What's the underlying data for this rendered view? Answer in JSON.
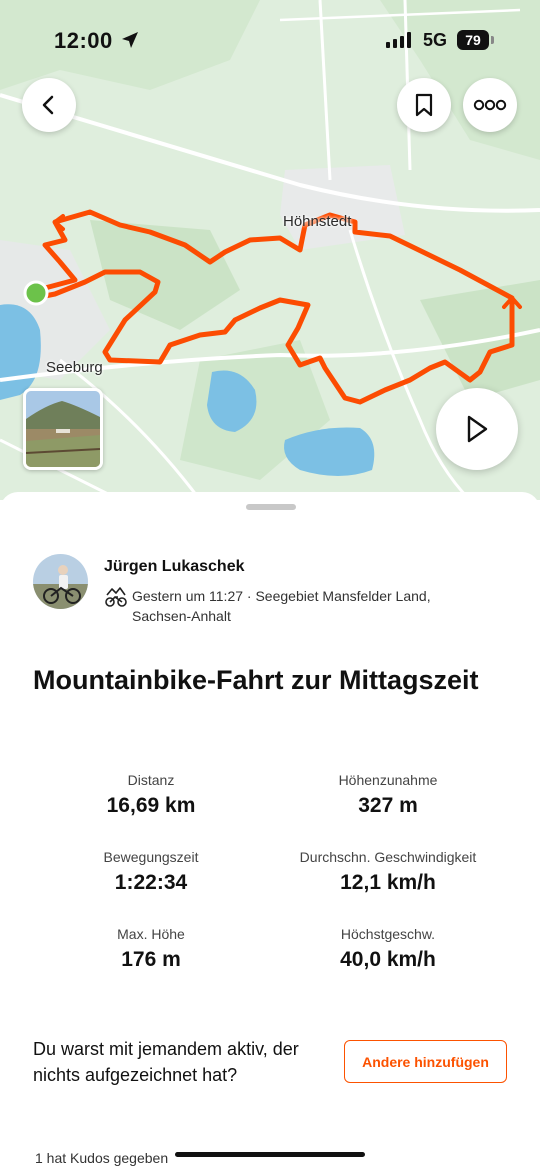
{
  "status_bar": {
    "time": "12:00",
    "network": "5G",
    "battery": "79"
  },
  "map": {
    "place_labels": [
      "Höhnstedt",
      "Seeburg"
    ],
    "route_color": "#fc4c02",
    "start_color": "#6cc24a"
  },
  "toolbar": {
    "back_icon": "chevron-left-icon",
    "bookmark_icon": "bookmark-icon",
    "more_icon": "more-horizontal-icon",
    "play_icon": "play-icon"
  },
  "activity": {
    "athlete_name": "Jürgen Lukaschek",
    "meta": "Gestern um 11:27 · Seegebiet Mansfelder Land, Sachsen-Anhalt",
    "activity_icon": "mountain-bike-icon",
    "title": "Mountainbike-Fahrt zur Mittagszeit"
  },
  "stats": [
    {
      "label": "Distanz",
      "value": "16,69 km"
    },
    {
      "label": "Höhenzunahme",
      "value": "327 m"
    },
    {
      "label": "Bewegungszeit",
      "value": "1:22:34"
    },
    {
      "label": "Durchschn. Geschwindigkeit",
      "value": "12,1 km/h"
    },
    {
      "label": "Max. Höhe",
      "value": "176 m"
    },
    {
      "label": "Höchstgeschw.",
      "value": "40,0 km/h"
    }
  ],
  "partner": {
    "question": "Du warst mit jemandem aktiv, der nichts aufgezeichnet hat?",
    "button_label": "Andere hinzufügen"
  },
  "kudos": {
    "text": "1 hat Kudos gegeben"
  },
  "colors": {
    "accent": "#fc5200",
    "map_bg": "#dfeedd",
    "water": "#7cc0e4"
  }
}
